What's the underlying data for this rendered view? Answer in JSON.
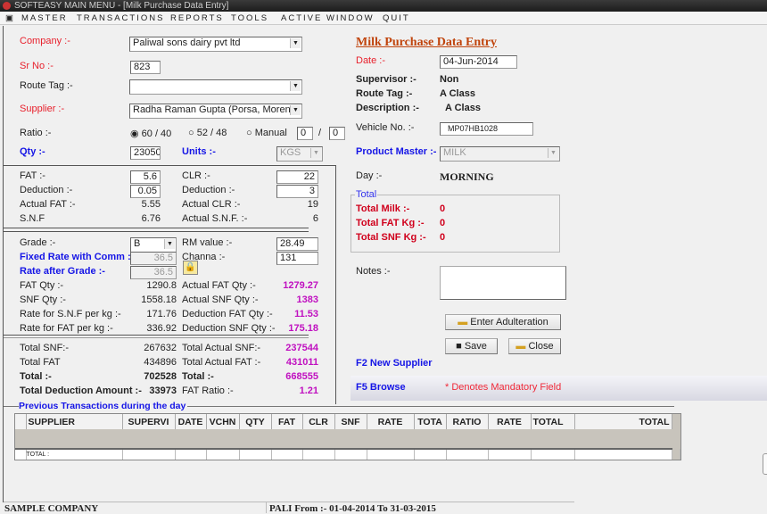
{
  "window": {
    "title": "SOFTEASY MAIN MENU - [Milk Purchase Data Entry]"
  },
  "menu": [
    "MASTER",
    "TRANSACTIONS",
    "REPORTS",
    "TOOLS",
    "ACTIVE WINDOW",
    "QUIT"
  ],
  "form": {
    "company_label": "Company :-",
    "company": "Paliwal sons dairy pvt ltd",
    "srno_label": "Sr No :-",
    "srno": "823",
    "route_label": "Route Tag :-",
    "route": "",
    "supplier_label": "Supplier :-",
    "supplier": "Radha Raman Gupta (Porsa, Morena",
    "ratio_label": "Ratio :-",
    "ratio_options": [
      "60 / 40",
      "52 / 48",
      "Manual"
    ],
    "ratio_selected": "60 / 40",
    "manual_a": "0",
    "manual_sep": "/",
    "manual_b": "0",
    "qty_label": "Qty :-",
    "qty": "23050",
    "units_label": "Units :-",
    "units": "KGS"
  },
  "quality": {
    "fat_label": "FAT :-",
    "fat": "5.6",
    "clr_label": "CLR :-",
    "clr": "22",
    "ded_label": "Deduction :-",
    "ded": "0.05",
    "ded2_label": "Deduction :-",
    "ded2": "3",
    "afat_label": "Actual FAT :-",
    "afat": "5.55",
    "aclr_label": "Actual CLR :-",
    "aclr": "19",
    "snf_label": "S.N.F",
    "snf": "6.76",
    "asnf_label": "Actual S.N.F. :-",
    "asnf": "6"
  },
  "rates": {
    "grade_label": "Grade :-",
    "grade": "B",
    "rm_label": "RM value :-",
    "rm": "28.49",
    "fixed_label": "Fixed Rate with Comm :-",
    "fixed": "36.5",
    "channa_label": "Channa :-",
    "channa": "131",
    "after_label": "Rate after Grade :-",
    "after": "36.5",
    "fatqty_label": "FAT Qty :-",
    "fatqty": "1290.8",
    "afatqty_label": "Actual FAT Qty :-",
    "afatqty": "1279.27",
    "snfqty_label": "SNF Qty :-",
    "snfqty": "1558.18",
    "asnfqty_label": "Actual SNF Qty :-",
    "asnfqty": "1383",
    "rsnf_label": "Rate for S.N.F per kg  :-",
    "rsnf": "171.76",
    "dfat_label": "Deduction FAT Qty :-",
    "dfat": "11.53",
    "rfat_label": "Rate for FAT per kg  :-",
    "rfat": "336.92",
    "dsnf_label": "Deduction SNF Qty :-",
    "dsnf": "175.18"
  },
  "totals": {
    "tsnf_label": "Total SNF:-",
    "tsnf": "267632",
    "tasnf_label": "Total Actual SNF:-",
    "tasnf": "237544",
    "tfat_label": "Total FAT",
    "tfat": "434896",
    "tafat_label": "Total Actual FAT :-",
    "tafat": "431011",
    "total_label": "Total :-",
    "total": "702528",
    "total2_label": "Total :-",
    "total2": "668555",
    "tded_label": "Total Deduction Amount :-",
    "tded": "33973",
    "fratio_label": "FAT Ratio :-",
    "fratio": "1.21"
  },
  "right": {
    "heading": "Milk Purchase Data Entry",
    "date_label": "Date :-",
    "date": "04-Jun-2014",
    "sup_label": "Supervisor :-",
    "sup": "Non",
    "route_label": "Route Tag :-",
    "route": "A Class",
    "desc_label": "Description :-",
    "desc": "A Class",
    "veh_label": "Vehicle No. :-",
    "veh": "MP07HB1028",
    "prod_label": "Product Master :-",
    "prod": "MILK",
    "day_label": "Day :-",
    "day": "MORNING",
    "total_legend": "Total",
    "tmilk_label": "Total Milk :-",
    "tmilk": "0",
    "tfat_label": "Total FAT Kg :-",
    "tfat": "0",
    "tsnf_label": "Total SNF Kg :-",
    "tsnf": "0",
    "notes_label": "Notes :-",
    "notes": "",
    "adult_btn": "Enter Adulteration",
    "save_btn": "Save",
    "close_btn": "Close",
    "f2": "F2 New Supplier",
    "f5": "F5 Browse",
    "mandatory": "* Denotes Mandatory Field"
  },
  "grid": {
    "title": "Previous Transactions during the day",
    "columns": [
      "SUPPLIER",
      "SUPERVI",
      "DATE",
      "VCHN",
      "QTY",
      "FAT",
      "CLR",
      "SNF",
      "RATE",
      "TOTA",
      "RATIO",
      "RATE",
      "TOTAL",
      "TOTAL"
    ],
    "total_label": "TOTAL :"
  },
  "status": {
    "company": "SAMPLE COMPANY",
    "period": "PALI From :- 01-04-2014 To 31-03-2015"
  }
}
